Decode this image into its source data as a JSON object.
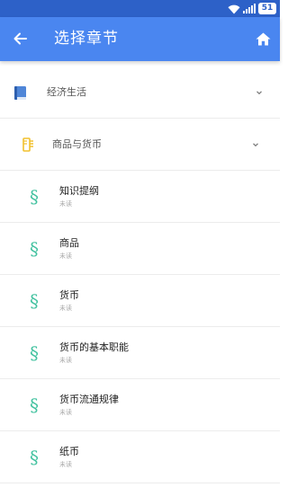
{
  "status_bar": {
    "battery": "51",
    "icons": [
      "wifi-icon",
      "signal-icon",
      "battery-icon"
    ]
  },
  "app_bar": {
    "title": "选择章节",
    "back_icon": "back-arrow-icon",
    "home_icon": "home-icon",
    "color": "#4a86f0"
  },
  "book": {
    "label": "经济生活",
    "icon": "book-icon"
  },
  "unit": {
    "label": "商品与货币",
    "icon": "pen-icon"
  },
  "sections": [
    {
      "title": "知识提纲",
      "status": "未读"
    },
    {
      "title": "商品",
      "status": "未读"
    },
    {
      "title": "货币",
      "status": "未读"
    },
    {
      "title": "货币的基本职能",
      "status": "未读"
    },
    {
      "title": "货币流通规律",
      "status": "未读"
    },
    {
      "title": "纸币",
      "status": "未读"
    }
  ],
  "section_icon": "section-sign-icon",
  "colors": {
    "accent": "#4a86f0",
    "section_icon": "#43c2a0",
    "pen_icon": "#f2c12e"
  }
}
